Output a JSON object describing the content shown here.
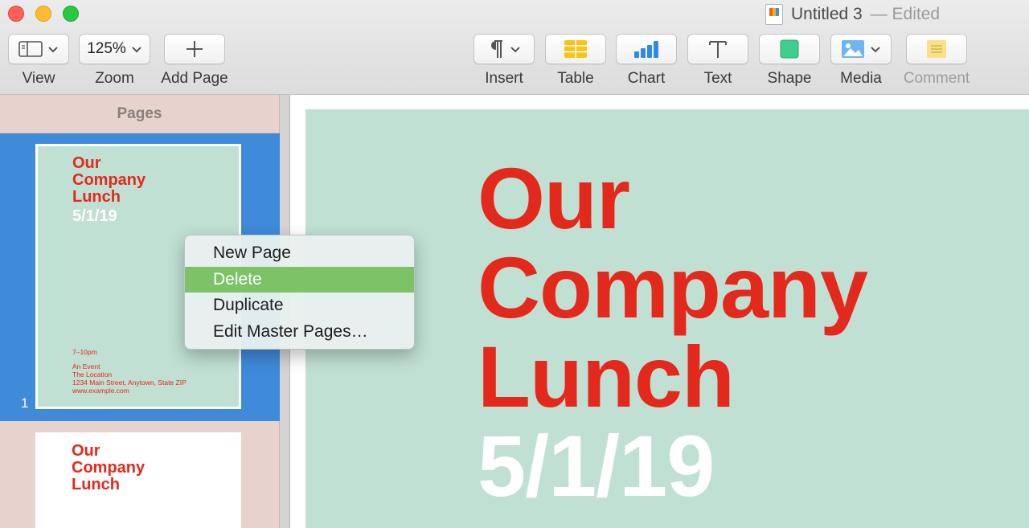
{
  "window": {
    "title": "Untitled 3",
    "edited_suffix": "— Edited"
  },
  "toolbar": {
    "view_label": "View",
    "zoom_value": "125%",
    "zoom_label": "Zoom",
    "add_page_label": "Add Page",
    "insert_label": "Insert",
    "table_label": "Table",
    "chart_label": "Chart",
    "text_label": "Text",
    "shape_label": "Shape",
    "media_label": "Media",
    "comment_label": "Comment"
  },
  "sidebar": {
    "header": "Pages",
    "pages": [
      {
        "number": "1",
        "title_lines": [
          "Our",
          "Company",
          "Lunch"
        ],
        "date": "5/1/19",
        "time": "7–10pm",
        "details": [
          "An Event",
          "The Location",
          "1234 Main Street, Anytown, State ZIP",
          "www.example.com"
        ]
      },
      {
        "title_lines": [
          "Our",
          "Company",
          "Lunch"
        ]
      }
    ]
  },
  "document": {
    "title_lines": [
      "Our",
      "Company",
      "Lunch"
    ],
    "date": "5/1/19"
  },
  "context_menu": {
    "items": [
      "New Page",
      "Delete",
      "Duplicate",
      "Edit Master Pages…"
    ],
    "highlighted": "Delete"
  },
  "colors": {
    "accent_red": "#e2291c",
    "page_green": "#c0e0d3",
    "selection_blue": "#3f8ad9",
    "menu_highlight": "#7cc266"
  }
}
